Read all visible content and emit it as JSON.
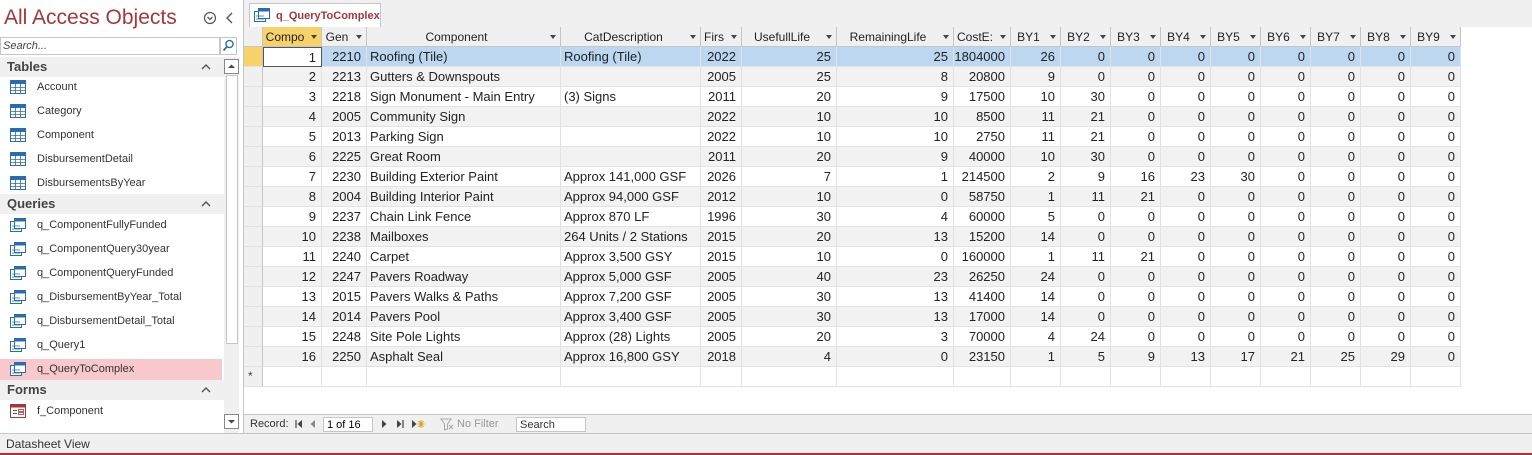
{
  "nav": {
    "title": "All Access Objects",
    "search_placeholder": "Search...",
    "groups": [
      {
        "label": "Tables",
        "items": [
          {
            "label": "Account"
          },
          {
            "label": "Category"
          },
          {
            "label": "Component"
          },
          {
            "label": "DisbursementDetail"
          },
          {
            "label": "DisbursementsByYear"
          }
        ]
      },
      {
        "label": "Queries",
        "items": [
          {
            "label": "q_ComponentFullyFunded"
          },
          {
            "label": "q_ComponentQuery30year"
          },
          {
            "label": "q_ComponentQueryFunded"
          },
          {
            "label": "q_DisbursementByYear_Total"
          },
          {
            "label": "q_DisbursementDetail_Total"
          },
          {
            "label": "q_Query1"
          },
          {
            "label": "q_QueryToComplex",
            "selected": true
          }
        ]
      },
      {
        "label": "Forms",
        "items": [
          {
            "label": "f_Component"
          }
        ]
      }
    ]
  },
  "document_tab": {
    "label": "q_QueryToComplex"
  },
  "datasheet": {
    "columns": [
      "Compo",
      "Gen",
      "Component",
      "CatDescription",
      "Firs",
      "UsefullLife",
      "RemainingLife",
      "CostE:",
      "BY1",
      "BY2",
      "BY3",
      "BY4",
      "BY5",
      "BY6",
      "BY7",
      "BY8",
      "BY9"
    ],
    "rows": [
      [
        "1",
        "2210",
        "Roofing (Tile)",
        "Roofing (Tile)",
        "2022",
        "25",
        "25",
        "1804000",
        "26",
        "0",
        "0",
        "0",
        "0",
        "0",
        "0",
        "0",
        "0"
      ],
      [
        "2",
        "2213",
        "Gutters & Downspouts",
        "",
        "2005",
        "25",
        "8",
        "20800",
        "9",
        "0",
        "0",
        "0",
        "0",
        "0",
        "0",
        "0",
        "0"
      ],
      [
        "3",
        "2218",
        "Sign Monument - Main Entry",
        "(3) Signs",
        "2011",
        "20",
        "9",
        "17500",
        "10",
        "30",
        "0",
        "0",
        "0",
        "0",
        "0",
        "0",
        "0"
      ],
      [
        "4",
        "2005",
        "Community Sign",
        "",
        "2022",
        "10",
        "10",
        "8500",
        "11",
        "21",
        "0",
        "0",
        "0",
        "0",
        "0",
        "0",
        "0"
      ],
      [
        "5",
        "2013",
        "Parking Sign",
        "",
        "2022",
        "10",
        "10",
        "2750",
        "11",
        "21",
        "0",
        "0",
        "0",
        "0",
        "0",
        "0",
        "0"
      ],
      [
        "6",
        "2225",
        "Great Room",
        "",
        "2011",
        "20",
        "9",
        "40000",
        "10",
        "30",
        "0",
        "0",
        "0",
        "0",
        "0",
        "0",
        "0"
      ],
      [
        "7",
        "2230",
        "Building Exterior Paint",
        "Approx 141,000 GSF",
        "2026",
        "7",
        "1",
        "214500",
        "2",
        "9",
        "16",
        "23",
        "30",
        "0",
        "0",
        "0",
        "0"
      ],
      [
        "8",
        "2004",
        "Building Interior Paint",
        "Approx 94,000 GSF",
        "2012",
        "10",
        "0",
        "58750",
        "1",
        "11",
        "21",
        "0",
        "0",
        "0",
        "0",
        "0",
        "0"
      ],
      [
        "9",
        "2237",
        "Chain Link Fence",
        "Approx 870 LF",
        "1996",
        "30",
        "4",
        "60000",
        "5",
        "0",
        "0",
        "0",
        "0",
        "0",
        "0",
        "0",
        "0"
      ],
      [
        "10",
        "2238",
        "Mailboxes",
        "264 Units / 2 Stations",
        "2015",
        "20",
        "13",
        "15200",
        "14",
        "0",
        "0",
        "0",
        "0",
        "0",
        "0",
        "0",
        "0"
      ],
      [
        "11",
        "2240",
        "Carpet",
        "Approx 3,500 GSY",
        "2015",
        "10",
        "0",
        "160000",
        "1",
        "11",
        "21",
        "0",
        "0",
        "0",
        "0",
        "0",
        "0"
      ],
      [
        "12",
        "2247",
        "Pavers Roadway",
        "Approx 5,000 GSF",
        "2005",
        "40",
        "23",
        "26250",
        "24",
        "0",
        "0",
        "0",
        "0",
        "0",
        "0",
        "0",
        "0"
      ],
      [
        "13",
        "2015",
        "Pavers Walks & Paths",
        "Approx 7,200 GSF",
        "2005",
        "30",
        "13",
        "41400",
        "14",
        "0",
        "0",
        "0",
        "0",
        "0",
        "0",
        "0",
        "0"
      ],
      [
        "14",
        "2014",
        "Pavers Pool",
        "Approx 3,400 GSF",
        "2005",
        "30",
        "13",
        "17000",
        "14",
        "0",
        "0",
        "0",
        "0",
        "0",
        "0",
        "0",
        "0"
      ],
      [
        "15",
        "2248",
        "Site Pole Lights",
        "Approx (28) Lights",
        "2005",
        "20",
        "3",
        "70000",
        "4",
        "24",
        "0",
        "0",
        "0",
        "0",
        "0",
        "0",
        "0"
      ],
      [
        "16",
        "2250",
        "Asphalt Seal",
        "Approx 16,800 GSY",
        "2018",
        "4",
        "0",
        "23150",
        "1",
        "5",
        "9",
        "13",
        "17",
        "21",
        "25",
        "29",
        "0"
      ]
    ],
    "new_row_marker": "*"
  },
  "record_nav": {
    "label": "Record:",
    "position": "1 of 16",
    "filter_label": "No Filter",
    "search_placeholder": "Search"
  },
  "status_bar": {
    "text": "Datasheet View"
  },
  "colors": {
    "accent": "#a4373a",
    "header_active": "#f7d26b",
    "selected_row": "#bcd7ef",
    "nav_selected": "#f7c9cc"
  }
}
